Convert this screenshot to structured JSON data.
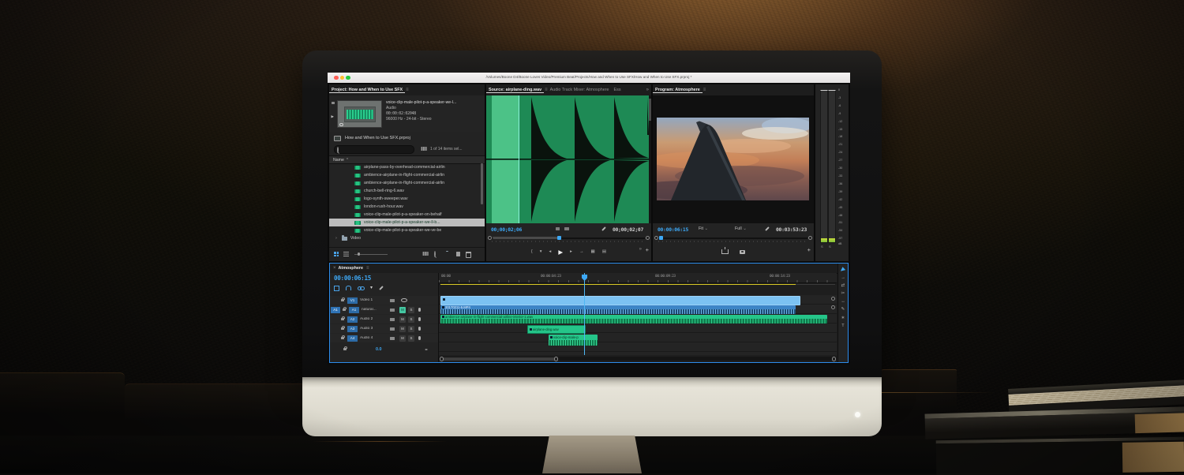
{
  "colors": {
    "accent_blue": "#2d8ceb",
    "timecode_blue": "#3da8f5",
    "audio_clip_green": "#25c589",
    "waveform_bg_green": "#1e8a55",
    "waveform_selected_green": "#4cc287",
    "video_clip_blue": "#7cc2f2",
    "a1_clip_blue": "#3d85c6",
    "work_area_yellow": "#d6c724",
    "traffic_red": "#ff5f56",
    "traffic_yellow": "#ffbd2e",
    "traffic_green": "#27c93f"
  },
  "window": {
    "title": "/Volumes/Boone D4/Boone Loves Video/Premium Beat/Projects/How and When to Use SFX/How and When to Use SFX.prproj *"
  },
  "project_panel": {
    "tab": "Project: How and When to Use SFX",
    "preview": {
      "name": "voice-clip-male-pilot-p-a-speaker-we-l...",
      "kind": "Audio",
      "duration": "00:00:02:02048",
      "format": "96000 Hz - 24-bit - Stereo"
    },
    "bin_name": "How and When to Use SFX.prproj",
    "selection_status": "1 of 14 items sel...",
    "list_header": "Name",
    "files": [
      {
        "name": "airplane-pass-by-overhead-commercial-airlin",
        "kind": "audio",
        "selected": false
      },
      {
        "name": "ambience-airplane-in-flight-commercial-airlin",
        "kind": "audio",
        "selected": false
      },
      {
        "name": "ambience-airplane-in-flight-commercial-airlin",
        "kind": "audio",
        "selected": false
      },
      {
        "name": "church-bell-ring-6.wav",
        "kind": "audio",
        "selected": false
      },
      {
        "name": "logo-synth-sweeper.wav",
        "kind": "audio",
        "selected": false
      },
      {
        "name": "london-rush-hour.wav",
        "kind": "audio",
        "selected": false
      },
      {
        "name": "voice-clip-male-pilot-p-a-speaker-on-behalf",
        "kind": "audio",
        "selected": false
      },
      {
        "name": "voice-clip-male-pilot-p-a-speaker-we-ll-b...",
        "kind": "audio",
        "selected": true
      },
      {
        "name": "voice-clip-male-pilot-p-a-speaker-we-ve-be",
        "kind": "audio",
        "selected": false
      },
      {
        "name": "Video",
        "kind": "folder",
        "selected": false
      }
    ]
  },
  "source_panel": {
    "tab_source": "Source: airplane-ding.wav",
    "tab_mixer": "Audio Track Mixer: Atmosphere",
    "tab_essential": "Ess",
    "timecode_current": "00;00;02;06",
    "timecode_total": "00;00;02;07"
  },
  "program_panel": {
    "tab": "Program: Atmosphere",
    "timecode_current": "00:00:06:15",
    "zoom_select": "Fit",
    "playback_resolution": "Full",
    "timecode_total": "00:03:53:23"
  },
  "audio_meter": {
    "scale": [
      "0",
      "-3",
      "-6",
      "-9",
      "-12",
      "-15",
      "-18",
      "-21",
      "-24",
      "-27",
      "-30",
      "-33",
      "-36",
      "-39",
      "-42",
      "-45",
      "-48",
      "-51",
      "-54",
      "-57"
    ],
    "unit": "dB",
    "solo_left": "S",
    "solo_right": "S"
  },
  "timeline": {
    "tab": "Atmosphere",
    "playhead_timecode": "00:00:06:15",
    "ruler_labels": [
      "00:00",
      "00:00:04:23",
      "00:00:09:23",
      "00:00:14:23"
    ],
    "tracks": [
      {
        "assign": "",
        "badge": "V1",
        "name": "Video 1"
      },
      {
        "assign": "A1",
        "badge": "A1",
        "name": "natural..."
      },
      {
        "assign": "",
        "badge": "A2",
        "name": "Audio 2"
      },
      {
        "assign": "",
        "badge": "A3",
        "name": "Audio 3"
      },
      {
        "assign": "",
        "badge": "A4",
        "name": "Audio 4"
      }
    ],
    "mute_label": "M",
    "solo_label": "S",
    "master_volume": "0.0",
    "clips": {
      "a1": "20170211-5.MP4",
      "a2": "ambience-airplane-in-flight-commercial-airline-interior-1.wav",
      "a3": "airplane-ding.wav",
      "a4": "voice-clip-male-p"
    }
  },
  "icons": {
    "menu": "≡",
    "close": "×",
    "overflow": "»",
    "add": "+",
    "chevron_down": "⌄",
    "sort_asc": "^",
    "disclosure": "›",
    "play": "▶",
    "step_back": "◂",
    "step_forward": "▸",
    "mark_in": "{",
    "mark_out": "}",
    "go_to_out": "→",
    "insert": "▦",
    "overwrite": "▤",
    "marker": "▾",
    "fit_toggle": "◂▸",
    "track_select": "→",
    "ripple": "⇄",
    "razor": "✂",
    "slip": "↔",
    "pen": "✎",
    "hand": "∗",
    "type": "T"
  }
}
